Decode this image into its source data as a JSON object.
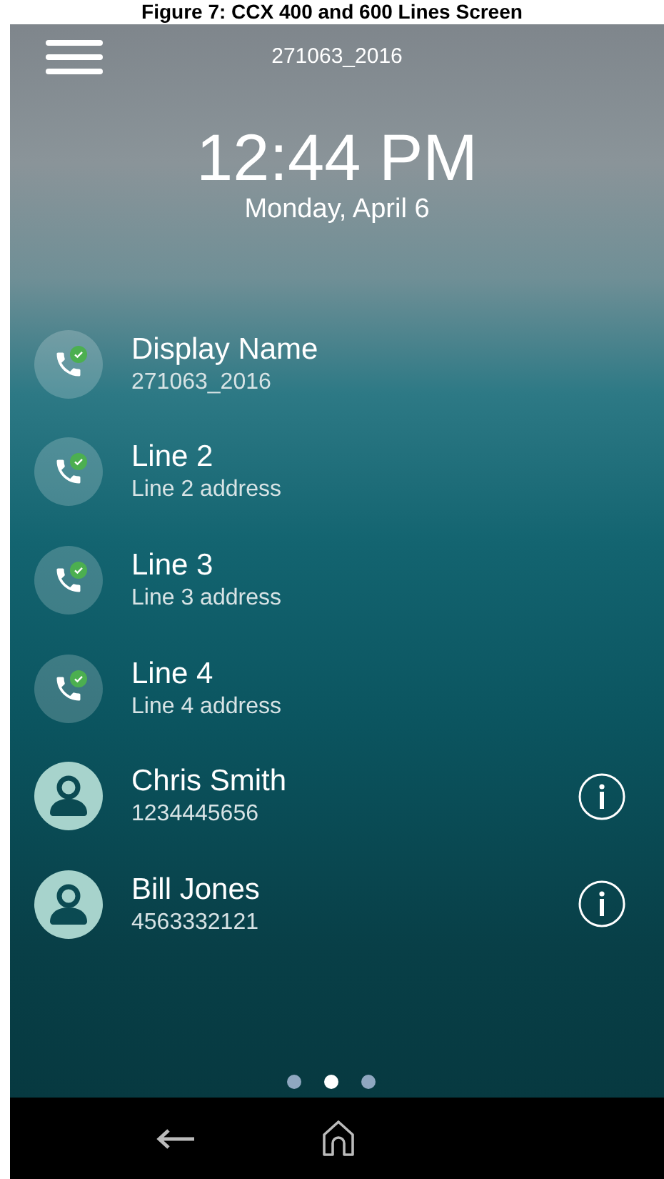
{
  "caption": "Figure 7: CCX 400 and 600 Lines Screen",
  "header": {
    "title": "271063_2016"
  },
  "clock": {
    "time": "12:44 PM",
    "date": "Monday, April 6"
  },
  "lines": [
    {
      "kind": "line",
      "name": "Display Name",
      "detail": "271063_2016",
      "registered": true
    },
    {
      "kind": "line",
      "name": "Line 2",
      "detail": "Line 2 address",
      "registered": true
    },
    {
      "kind": "line",
      "name": "Line 3",
      "detail": "Line 3 address",
      "registered": true
    },
    {
      "kind": "line",
      "name": "Line 4",
      "detail": "Line 4 address",
      "registered": true
    },
    {
      "kind": "contact",
      "name": "Chris Smith",
      "detail": "1234445656"
    },
    {
      "kind": "contact",
      "name": "Bill Jones",
      "detail": "4563332121"
    }
  ],
  "pages": [
    {
      "selected": false
    },
    {
      "selected": true
    },
    {
      "selected": false
    }
  ]
}
